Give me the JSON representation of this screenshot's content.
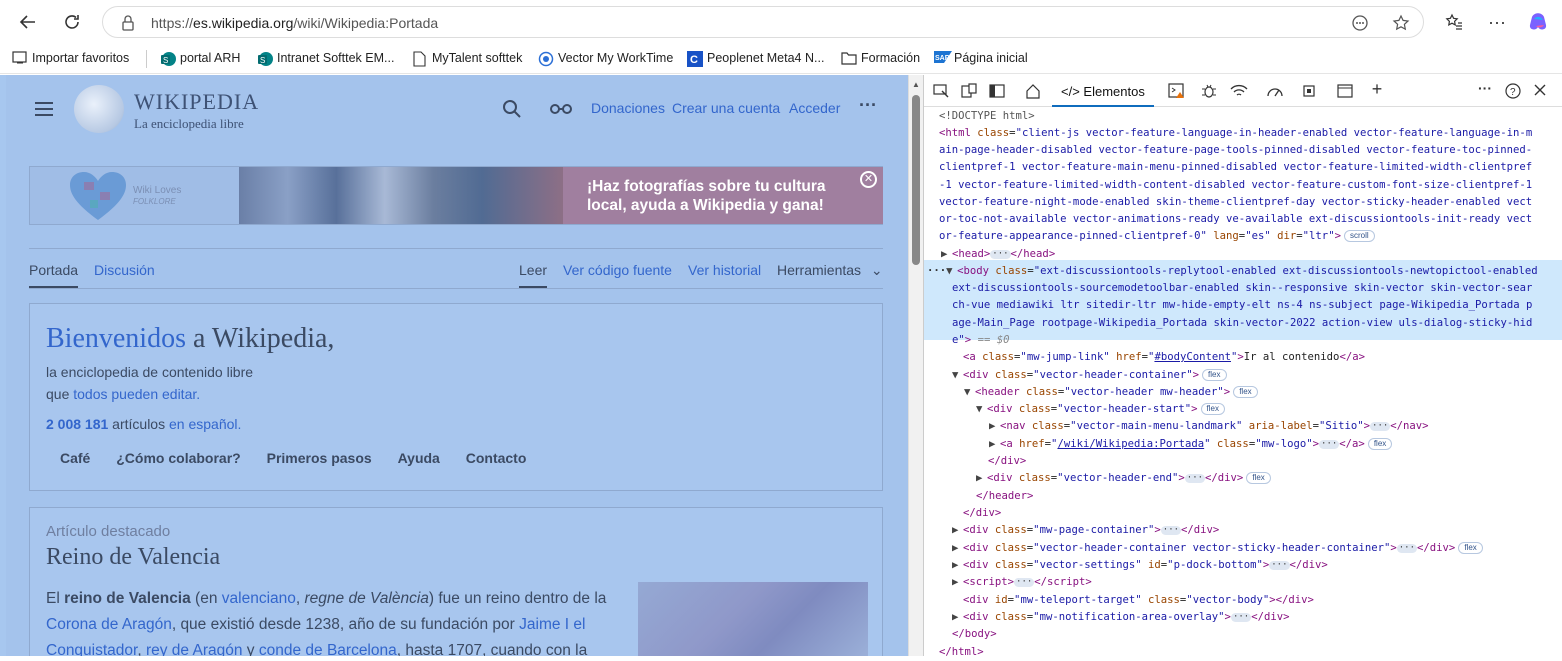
{
  "browser": {
    "url_prefix": "https://",
    "url_host": "es.wikipedia.org",
    "url_path": "/wiki/Wikipedia:Portada",
    "bookmarks": [
      {
        "label": "Importar favoritos",
        "icon": "import-icon"
      },
      {
        "label": "portal ARH",
        "icon": "sharepoint-icon"
      },
      {
        "label": "Intranet Softtek EM...",
        "icon": "sharepoint-icon"
      },
      {
        "label": "MyTalent softtek",
        "icon": "page-icon"
      },
      {
        "label": "Vector My WorkTime",
        "icon": "vector-icon"
      },
      {
        "label": "Peoplenet Meta4 N...",
        "icon": "peoplenet-icon"
      },
      {
        "label": "Formación",
        "icon": "folder-icon"
      },
      {
        "label": "Página inicial",
        "icon": "sap-icon"
      }
    ]
  },
  "wiki": {
    "logo_title": "WIKIPEDIA",
    "logo_subtitle": "La enciclopedia libre",
    "donate": "Donaciones",
    "create_account": "Crear una cuenta",
    "login": "Acceder",
    "banner_wiki_loves": "Wiki Loves",
    "banner_folklore": "FOLKLORE",
    "banner_msg_1": "¡Haz fotografías sobre tu cultura",
    "banner_msg_2": "local, ayuda a Wikipedia y gana!",
    "tab_portada": "Portada",
    "tab_discusion": "Discusión",
    "tab_leer": "Leer",
    "tab_codigo": "Ver código fuente",
    "tab_historial": "Ver historial",
    "tab_herramientas": "Herramientas",
    "welcome_blue": "Bienvenidos",
    "welcome_rest": " a Wikipedia,",
    "line1": "la enciclopedia de contenido libre",
    "line2_a": "que ",
    "line2_link": "todos pueden editar.",
    "count": "2 008 181",
    "count_text": " artículos ",
    "count_link": "en español.",
    "links": [
      "Café",
      "¿Cómo colaborar?",
      "Primeros pasos",
      "Ayuda",
      "Contacto"
    ],
    "featured_label": "Artículo destacado",
    "featured_title": "Reino de Valencia",
    "p1_a": "El ",
    "p1_b": "reino de Valencia",
    "p1_c": " (en ",
    "p1_d": "valenciano",
    "p1_e": ", ",
    "p1_f": "regne de València",
    "p1_g": ") fue un reino dentro de la",
    "p2_a": "Corona de Aragón",
    "p2_b": ", que existió desde 1238, año de su fundación por ",
    "p2_c": "Jaime I el",
    "p3_a": "Conquistador",
    "p3_b": ", ",
    "p3_c": "rey de Aragón",
    "p3_d": " y ",
    "p3_e": "conde de Barcelona",
    "p3_f": ", hasta 1707, cuando con la"
  },
  "devtools": {
    "elements_tab": "Elementos",
    "lines": {
      "doctype": "<!DOCTYPE html>",
      "html_class": "client-js vector-feature-language-in-header-enabled vector-feature-language-in-m",
      "html_class2": "ain-page-header-disabled vector-feature-page-tools-pinned-disabled vector-feature-toc-pinned-",
      "html_class3": "clientpref-1 vector-feature-main-menu-pinned-disabled vector-feature-limited-width-clientpref",
      "html_class4": "-1 vector-feature-limited-width-content-disabled vector-feature-custom-font-size-clientpref-1",
      "html_class5": "vector-feature-night-mode-enabled skin-theme-clientpref-day vector-sticky-header-enabled vect",
      "html_class6": "or-toc-not-available vector-animations-ready ve-available ext-discussiontools-init-ready vect",
      "html_class7": "or-feature-appearance-pinned-clientpref-0",
      "lang": "es",
      "dir": "ltr",
      "scroll": "scroll",
      "body1": "ext-discussiontools-replytool-enabled ext-discussiontools-newtopictool-enabled",
      "body2": "ext-discussiontools-sourcemodetoolbar-enabled skin--responsive skin-vector skin-vector-sear",
      "body3": "ch-vue mediawiki ltr sitedir-ltr mw-hide-empty-elt ns-4 ns-subject page-Wikipedia_Portada p",
      "body4": "age-Main_Page rootpage-Wikipedia_Portada skin-vector-2022 action-view uls-dialog-sticky-hid",
      "body5": "e",
      "eq": "== $0",
      "jump_class": "mw-jump-link",
      "jump_href": "#bodyContent",
      "jump_text": "Ir al contenido",
      "flex": "flex",
      "hdr_container": "vector-header-container",
      "hdr": "vector-header mw-header",
      "hdr_start": "vector-header-start",
      "nav_class": "vector-main-menu-landmark",
      "nav_label": "Sitio",
      "logo_href": "/wiki/Wikipedia:Portada",
      "logo_class": "mw-logo",
      "hdr_end": "vector-header-end",
      "page_container": "mw-page-container",
      "sticky": "vector-header-container vector-sticky-header-container",
      "settings": "vector-settings",
      "settings_id": "p-dock-bottom",
      "teleport_id": "mw-teleport-target",
      "teleport_class": "vector-body",
      "notif": "mw-notification-area-overlay"
    }
  }
}
